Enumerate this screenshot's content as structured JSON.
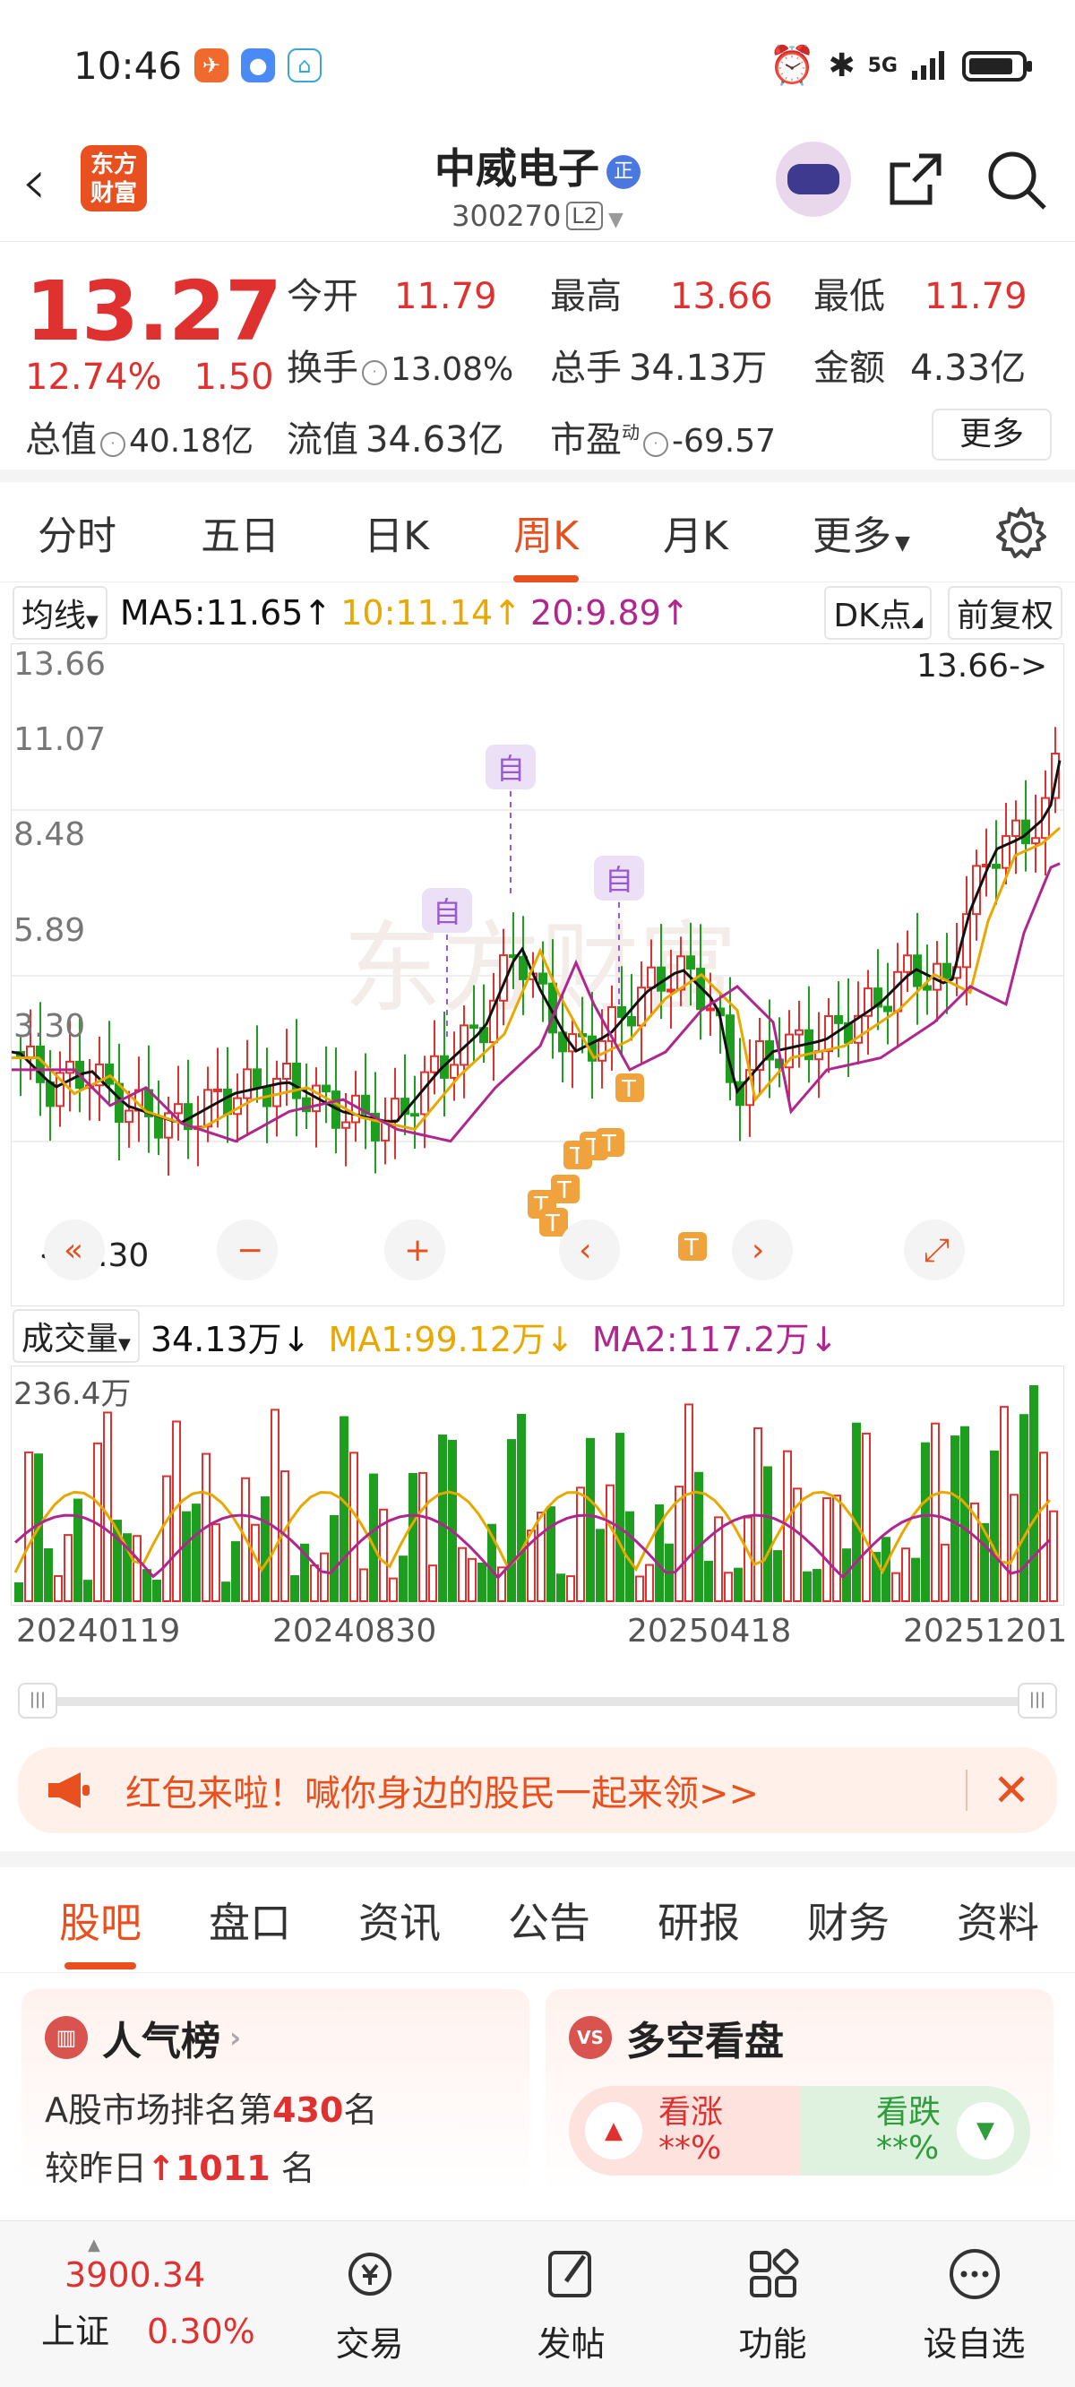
{
  "status_bar": {
    "time": "10:46",
    "network": "5G"
  },
  "header": {
    "logo_text": "东方财富",
    "stock_name": "中威电子",
    "name_badge": "正",
    "stock_code": "300270",
    "level_badge": "L2"
  },
  "quote": {
    "price": "13.27",
    "change_pct": "12.74%",
    "change": "1.50",
    "open_label": "今开",
    "open": "11.79",
    "high_label": "最高",
    "high": "13.66",
    "low_label": "最低",
    "low": "11.79",
    "turnover_label": "换手",
    "turnover": "13.08%",
    "volume_label": "总手",
    "volume": "34.13万",
    "amount_label": "金额",
    "amount": "4.33亿",
    "mktcap_label": "总值",
    "mktcap": "40.18亿",
    "float_label": "流值",
    "float": "34.63亿",
    "pe_label": "市盈",
    "pe_sup": "动",
    "pe": "-69.57",
    "more_button": "更多"
  },
  "period_tabs": [
    "分时",
    "五日",
    "日K",
    "周K",
    "月K",
    "更多"
  ],
  "active_period": 3,
  "ma_bar": {
    "indicator": "均线",
    "ma5": "MA5:11.65↑",
    "ma10": "10:11.14↑",
    "ma20": "20:9.89↑",
    "dk_button": "DK点",
    "adjust_button": "前复权",
    "colors": {
      "ma5": "#111111",
      "ma10": "#e8a800",
      "ma20": "#b0268f",
      "up": "#e03131",
      "down": "#1e9e1e",
      "marker": "#f0a33c",
      "self": "#9b59d0"
    }
  },
  "chart_data": {
    "type": "candlestick",
    "y_ticks": [
      "13.66",
      "11.07",
      "8.48",
      "5.89",
      "3.30"
    ],
    "ylim": [
      3.3,
      13.66
    ],
    "max_label": "13.66->",
    "min_label": "<-3.30",
    "annotations": [
      "自",
      "自",
      "自"
    ],
    "trade_markers": [
      "T",
      "T",
      "T",
      "T",
      "T",
      "T",
      "T",
      "T"
    ],
    "volume": {
      "indicator": "成交量",
      "current": "34.13万↓",
      "ma1": "MA1:99.12万↓",
      "ma2": "MA2:117.2万↓",
      "max_label": "236.4万"
    },
    "x_labels": [
      "20240119",
      "20240830",
      "20250418",
      "20251201"
    ]
  },
  "banner": {
    "text": "红包来啦！喊你身边的股民一起来领>>"
  },
  "info_tabs": [
    "股吧",
    "盘口",
    "资讯",
    "公告",
    "研报",
    "财务",
    "资料"
  ],
  "active_info_tab": 0,
  "popularity": {
    "title": "人气榜",
    "line1_prefix": "A股市场排名第",
    "rank": "430",
    "line1_suffix": "名",
    "line2_prefix": "较昨日",
    "rise": "1011",
    "line2_suffix": " 名"
  },
  "vs_card": {
    "title": "多空看盘",
    "bull_label": "看涨",
    "bull_value": "**%",
    "bear_label": "看跌",
    "bear_value": "**%"
  },
  "bottom_bar": {
    "index_value": "3900.34",
    "index_name": "上证",
    "index_change": "0.30%",
    "nav": [
      "交易",
      "发帖",
      "功能",
      "设自选"
    ]
  }
}
